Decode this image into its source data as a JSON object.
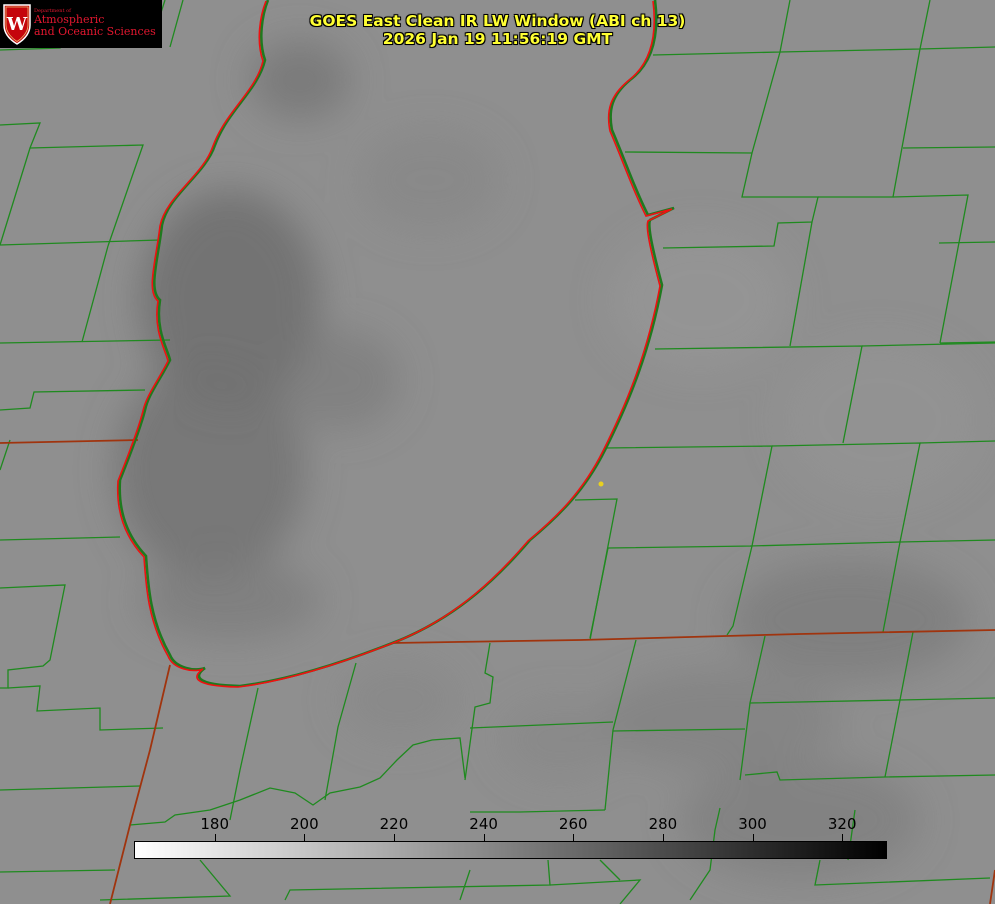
{
  "logo": {
    "dept": "Department of",
    "line1": "Atmospheric",
    "line2": "and Oceanic Sciences",
    "crest_letter": "W"
  },
  "header": {
    "title": "GOES East Clean IR LW Window (ABI ch 13)",
    "timestamp": "2026 Jan 19 11:56:19 GMT"
  },
  "colorbar": {
    "ticks": [
      "180",
      "200",
      "220",
      "240",
      "260",
      "280",
      "300",
      "320"
    ],
    "tick_values": [
      180,
      200,
      220,
      240,
      260,
      280,
      300,
      320
    ],
    "range": [
      162,
      330
    ],
    "gradient": [
      "#ffffff",
      "#000000"
    ]
  },
  "map_colors": {
    "background": "#8f8f8f",
    "lake_outline": "#ee1111",
    "county_lines": "#1f8a1f",
    "state_lines": "#a0340e",
    "marker": "#e8d020"
  }
}
